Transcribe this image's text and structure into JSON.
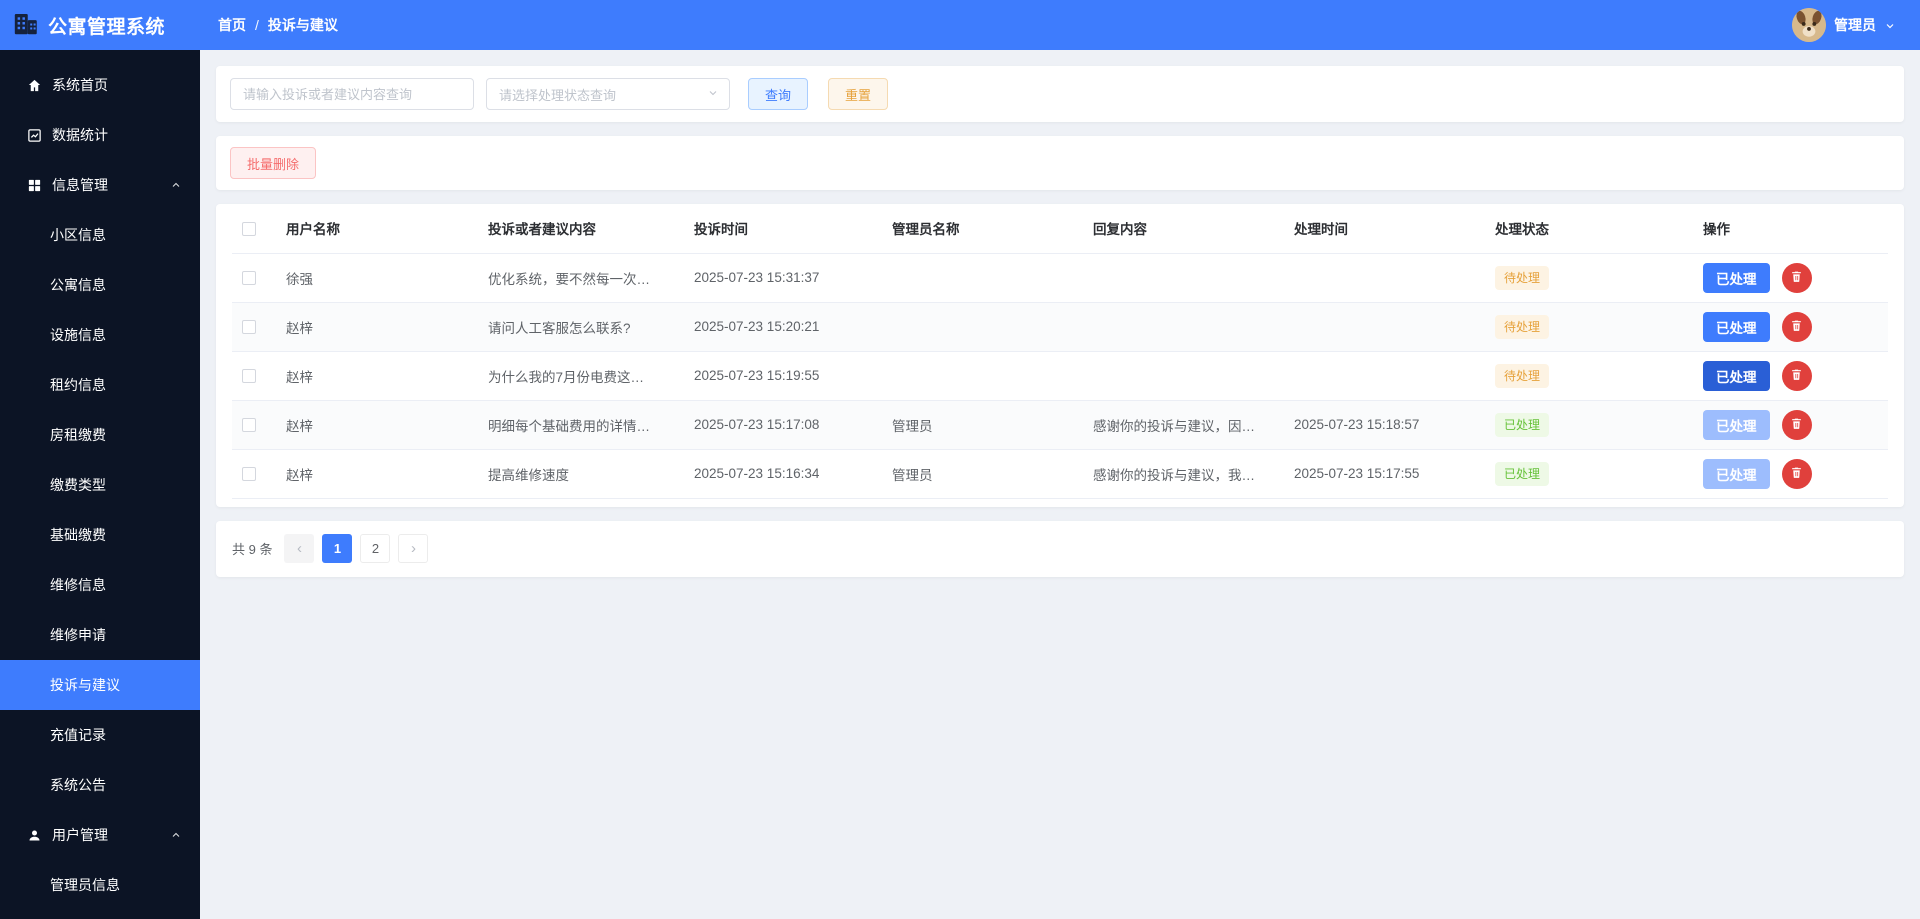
{
  "colors": {
    "primary": "#3e7cfd",
    "sidebar_bg": "#0c1425",
    "pending_text": "#e6a23c",
    "pending_bg": "#fdf3e3",
    "done_text": "#67c23a",
    "done_bg": "#eef9e6",
    "danger": "#e0403c"
  },
  "header": {
    "app_title": "公寓管理系统",
    "logo_icon": "building-icon",
    "breadcrumb": [
      "首页",
      "投诉与建议"
    ],
    "breadcrumb_separator": "/",
    "user_name": "管理员",
    "avatar_icon": "dog-avatar"
  },
  "sidebar": {
    "active_item": "投诉与建议",
    "sections": [
      {
        "label": "系统首页",
        "icon": "home-icon"
      },
      {
        "label": "数据统计",
        "icon": "chart-icon"
      },
      {
        "label": "信息管理",
        "icon": "grid-icon",
        "expanded": true,
        "children": [
          "小区信息",
          "公寓信息",
          "设施信息",
          "租约信息",
          "房租缴费",
          "缴费类型",
          "基础缴费",
          "维修信息",
          "维修申请",
          "投诉与建议",
          "充值记录",
          "系统公告"
        ]
      },
      {
        "label": "用户管理",
        "icon": "user-icon",
        "expanded": true,
        "children": [
          "管理员信息"
        ]
      }
    ]
  },
  "filters": {
    "search_placeholder": "请输入投诉或者建议内容查询",
    "status_placeholder": "请选择处理状态查询",
    "query_label": "查询",
    "reset_label": "重置"
  },
  "toolbar": {
    "batch_delete_label": "批量删除"
  },
  "table": {
    "columns": [
      "用户名称",
      "投诉或者建议内容",
      "投诉时间",
      "管理员名称",
      "回复内容",
      "处理时间",
      "处理状态",
      "操作"
    ],
    "handle_button_label": "已处理",
    "rows": [
      {
        "user": "徐强",
        "content": "优化系统，要不然每一次…",
        "complaint_time": "2025-07-23 15:31:37",
        "admin_name": "",
        "reply": "",
        "handle_time": "",
        "status": "待处理",
        "status_type": "pending",
        "handle_enabled": true,
        "handle_focused": false
      },
      {
        "user": "赵梓",
        "content": "请问人工客服怎么联系?",
        "complaint_time": "2025-07-23 15:20:21",
        "admin_name": "",
        "reply": "",
        "handle_time": "",
        "status": "待处理",
        "status_type": "pending",
        "handle_enabled": true,
        "handle_focused": false
      },
      {
        "user": "赵梓",
        "content": "为什么我的7月份电费这…",
        "complaint_time": "2025-07-23 15:19:55",
        "admin_name": "",
        "reply": "",
        "handle_time": "",
        "status": "待处理",
        "status_type": "pending",
        "handle_enabled": true,
        "handle_focused": true
      },
      {
        "user": "赵梓",
        "content": "明细每个基础费用的详情…",
        "complaint_time": "2025-07-23 15:17:08",
        "admin_name": "管理员",
        "reply": "感谢你的投诉与建议，因…",
        "handle_time": "2025-07-23 15:18:57",
        "status": "已处理",
        "status_type": "done",
        "handle_enabled": false,
        "handle_focused": false
      },
      {
        "user": "赵梓",
        "content": "提高维修速度",
        "complaint_time": "2025-07-23 15:16:34",
        "admin_name": "管理员",
        "reply": "感谢你的投诉与建议，我…",
        "handle_time": "2025-07-23 15:17:55",
        "status": "已处理",
        "status_type": "done",
        "handle_enabled": false,
        "handle_focused": false
      }
    ]
  },
  "pagination": {
    "total_label": "共 9 条",
    "prev_label": "‹",
    "next_label": "›",
    "pages": [
      "1",
      "2"
    ],
    "current_page": "1"
  }
}
